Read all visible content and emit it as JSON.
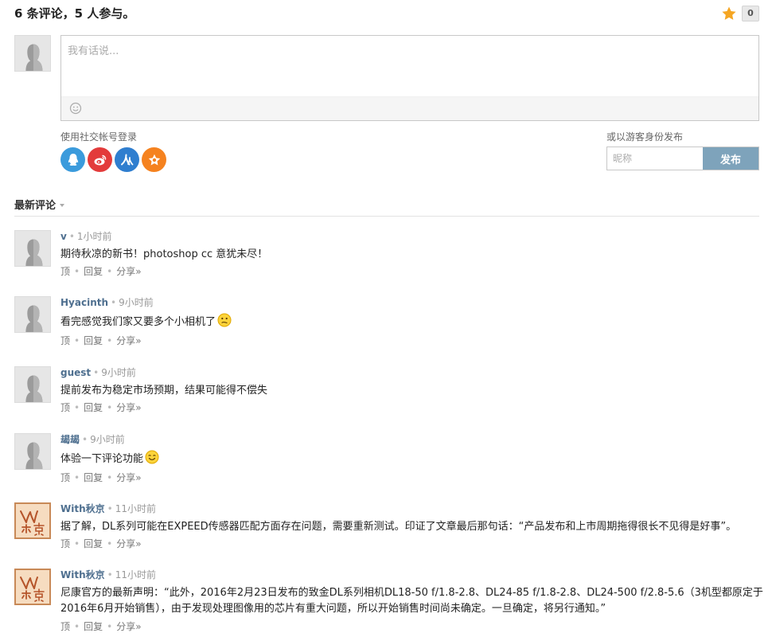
{
  "header": {
    "title": "6 条评论，5 人参与。",
    "like_count": "0"
  },
  "reply": {
    "placeholder": "我有话说..."
  },
  "login": {
    "social_label": "使用社交帐号登录",
    "guest_label": "或以游客身份发布",
    "nickname_placeholder": "昵称",
    "publish_label": "发布",
    "social_icons": [
      "qq-icon",
      "weibo-icon",
      "renren-icon",
      "douban-icon"
    ]
  },
  "tabs": {
    "latest_label": "最新评论"
  },
  "actions": {
    "top": "顶",
    "reply": "回复",
    "share": "分享»",
    "sep": "•"
  },
  "comments": [
    {
      "author": "v",
      "time": "1小时前",
      "text": "期待秋凉的新书！photoshop cc 意犹未尽！",
      "avatar": "default",
      "emoji": ""
    },
    {
      "author": "Hyacinth",
      "time": "9小时前",
      "text": "看完感觉我们家又要多个小相机了",
      "avatar": "default",
      "emoji": "thinking-emoji"
    },
    {
      "author": "guest",
      "time": "9小时前",
      "text": "提前发布为稳定市场预期，结果可能得不偿失",
      "avatar": "default",
      "emoji": ""
    },
    {
      "author": "朅朅",
      "time": "9小时前",
      "text": "体验一下评论功能",
      "avatar": "default",
      "emoji": "smile-emoji"
    },
    {
      "author": "With秋京",
      "time": "11小时前",
      "text": "据了解，DL系列可能在EXPEED传感器匹配方面存在问题，需要重新测试。印证了文章最后那句话：“产品发布和上市周期拖得很长不见得是好事”。",
      "avatar": "brand",
      "emoji": ""
    },
    {
      "author": "With秋京",
      "time": "11小时前",
      "text": "尼康官方的最新声明：“此外，2016年2月23日发布的致金DL系列相机DL18-50 f/1.8-2.8、DL24-85 f/1.8-2.8、DL24-500 f/2.8-5.6（3机型都原定于2016年6月开始销售），由于发现处理图像用的芯片有重大问题，所以开始销售时间尚未确定。一旦确定，将另行通知。”",
      "avatar": "brand",
      "emoji": ""
    }
  ],
  "colors": {
    "author": "#4e6f8f",
    "publish_button": "#7ea3bb",
    "star": "#f5a623",
    "qq": "#3b9bdc",
    "weibo": "#e33b3b",
    "renren": "#2f7ecf",
    "douban": "#f5821f"
  }
}
